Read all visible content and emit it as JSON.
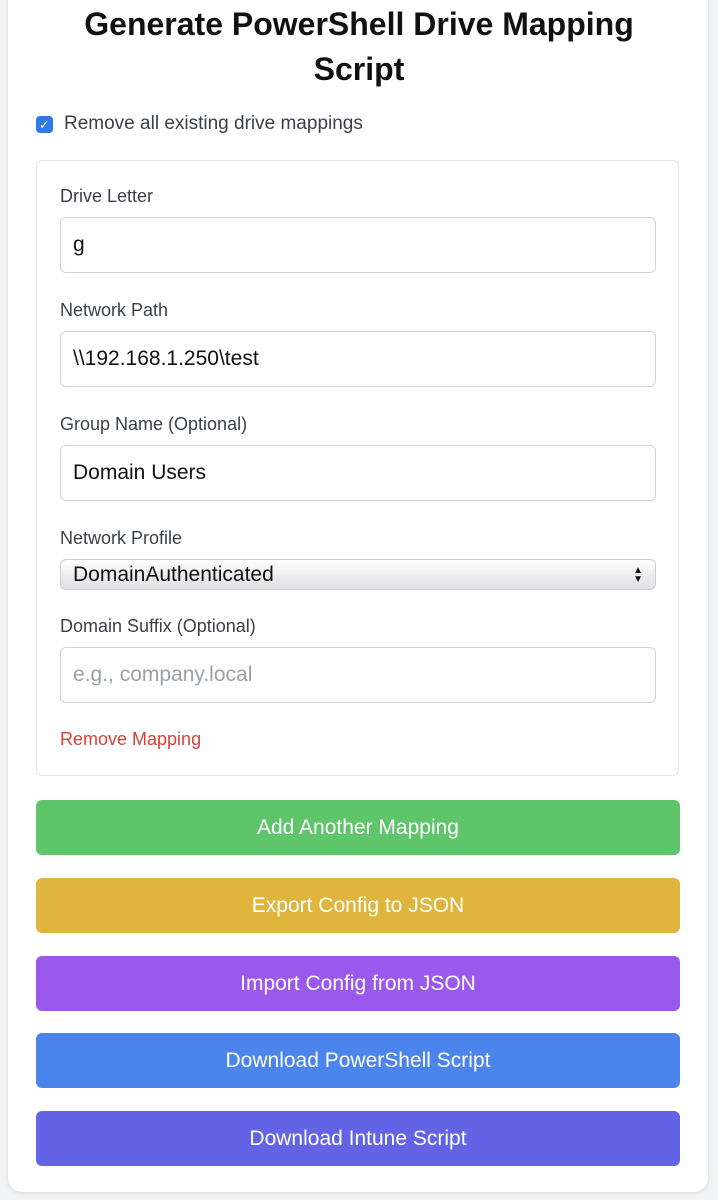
{
  "page": {
    "title_line1": "Generate PowerShell Drive Mapping",
    "title_line2": "Script"
  },
  "options": {
    "remove_all_label": "Remove all existing drive mappings",
    "remove_all_checked": true
  },
  "mapping": {
    "drive_letter": {
      "label": "Drive Letter",
      "value": "g"
    },
    "network_path": {
      "label": "Network Path",
      "value": "\\\\192.168.1.250\\test"
    },
    "group_name": {
      "label": "Group Name (Optional)",
      "value": "Domain Users"
    },
    "network_profile": {
      "label": "Network Profile",
      "selected": "DomainAuthenticated"
    },
    "domain_suffix": {
      "label": "Domain Suffix (Optional)",
      "value": "",
      "placeholder": "e.g., company.local"
    },
    "remove_label": "Remove Mapping"
  },
  "buttons": {
    "add": "Add Another Mapping",
    "export": "Export Config to JSON",
    "import": "Import Config from JSON",
    "download_ps": "Download PowerShell Script",
    "download_intune": "Download Intune Script"
  },
  "colors": {
    "add": "#5fc56b",
    "export": "#e0b53e",
    "import": "#9b58ec",
    "download_ps": "#4b84ea",
    "download_intune": "#6363e6",
    "remove_link": "#dc3e34",
    "checkbox": "#2f7be6"
  }
}
